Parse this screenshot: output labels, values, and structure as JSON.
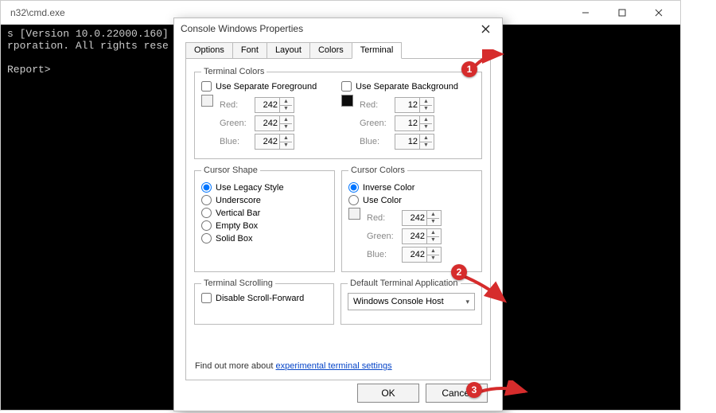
{
  "cmd": {
    "title": "n32\\cmd.exe",
    "line1": "s [Version 10.0.22000.160]",
    "line2": "rporation. All rights rese",
    "prompt": "Report>"
  },
  "dialog": {
    "title": "Console Windows Properties",
    "tabs": {
      "options": "Options",
      "font": "Font",
      "layout": "Layout",
      "colors": "Colors",
      "terminal": "Terminal"
    },
    "terminal_colors": {
      "legend": "Terminal Colors",
      "sep_fg": "Use Separate Foreground",
      "sep_bg": "Use Separate Background",
      "red": "Red:",
      "green": "Green:",
      "blue": "Blue:",
      "fg_r": "242",
      "fg_g": "242",
      "fg_b": "242",
      "bg_r": "12",
      "bg_g": "12",
      "bg_b": "12"
    },
    "cursor_shape": {
      "legend": "Cursor Shape",
      "legacy": "Use Legacy Style",
      "underscore": "Underscore",
      "vbar": "Vertical Bar",
      "empty": "Empty Box",
      "solid": "Solid Box"
    },
    "cursor_colors": {
      "legend": "Cursor Colors",
      "inverse": "Inverse Color",
      "use_color": "Use Color",
      "r": "242",
      "g": "242",
      "b": "242"
    },
    "scrolling": {
      "legend": "Terminal Scrolling",
      "disable": "Disable Scroll-Forward"
    },
    "default_app": {
      "legend": "Default Terminal Application",
      "value": "Windows Console Host"
    },
    "findout_prefix": "Find out more about ",
    "findout_link": "experimental terminal settings",
    "ok": "OK",
    "cancel": "Cancel"
  },
  "annotations": {
    "n1": "1",
    "n2": "2",
    "n3": "3"
  }
}
